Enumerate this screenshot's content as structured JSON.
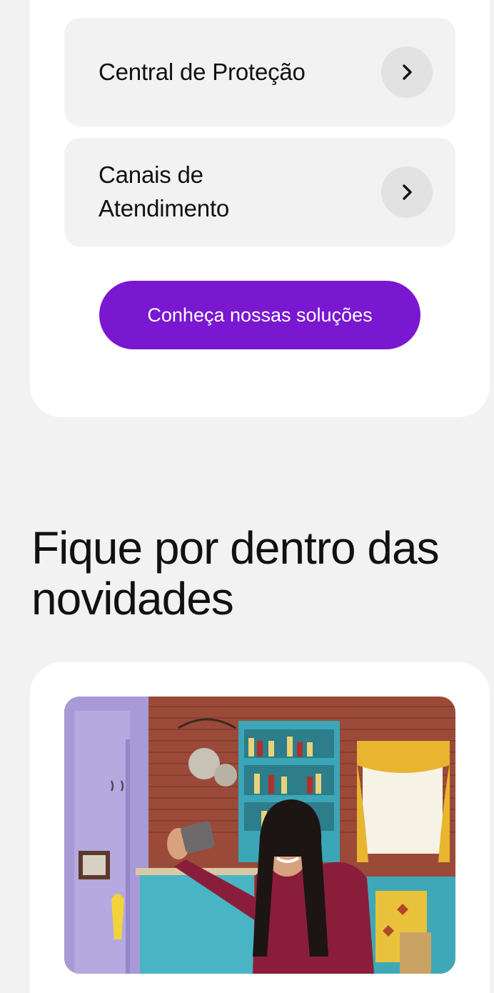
{
  "links": [
    {
      "label": "Central de Proteção",
      "icon": "chevron-right-icon"
    },
    {
      "label": "Canais de Atendimento",
      "icon": "chevron-right-icon"
    }
  ],
  "cta": {
    "label": "Conheça nossas soluções",
    "color": "#7a17d0"
  },
  "news": {
    "title": "Fique por dentro das novidades",
    "image": {
      "kind": "photo",
      "subject": "news-card-photo"
    }
  },
  "colors": {
    "page_bg": "#f2f2f2",
    "card_bg": "#ffffff",
    "item_bg": "#f2f2f2",
    "text": "#111111"
  }
}
